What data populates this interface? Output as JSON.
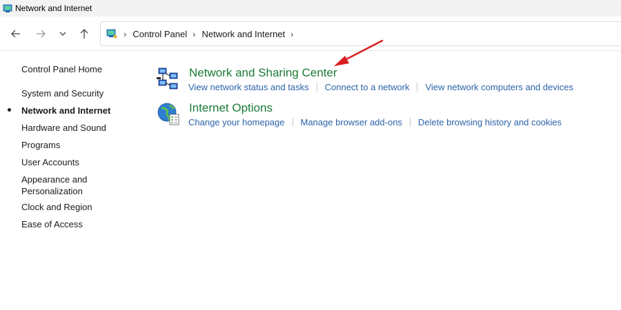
{
  "window": {
    "title": "Network and Internet"
  },
  "breadcrumb": {
    "items": [
      "Control Panel",
      "Network and Internet"
    ]
  },
  "sidebar": {
    "items": [
      {
        "label": "Control Panel Home"
      },
      {
        "label": "System and Security"
      },
      {
        "label": "Network and Internet",
        "active": true
      },
      {
        "label": "Hardware and Sound"
      },
      {
        "label": "Programs"
      },
      {
        "label": "User Accounts"
      },
      {
        "label": "Appearance and Personalization"
      },
      {
        "label": "Clock and Region"
      },
      {
        "label": "Ease of Access"
      }
    ]
  },
  "categories": [
    {
      "title": "Network and Sharing Center",
      "icon": "network-sharing-icon",
      "links": [
        "View network status and tasks",
        "Connect to a network",
        "View network computers and devices"
      ]
    },
    {
      "title": "Internet Options",
      "icon": "internet-options-icon",
      "links": [
        "Change your homepage",
        "Manage browser add-ons",
        "Delete browsing history and cookies"
      ]
    }
  ],
  "colors": {
    "category_title": "#1b7a37",
    "link": "#2a63a8",
    "annotation_arrow": "#d92020"
  }
}
